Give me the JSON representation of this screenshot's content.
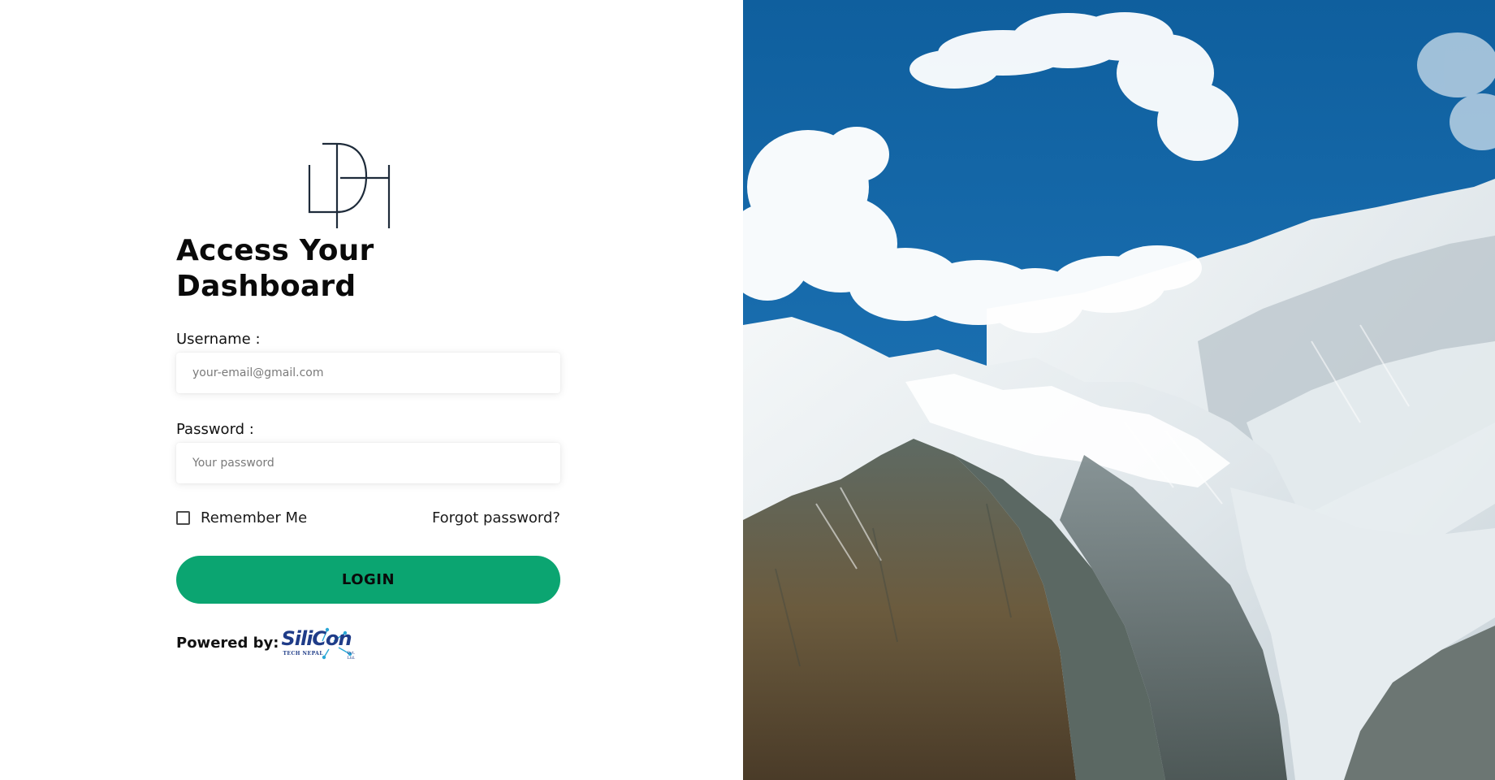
{
  "login": {
    "title": "Access Your Dashboard",
    "username_label": "Username :",
    "username_placeholder": "your-email@gmail.com",
    "password_label": "Password :",
    "password_placeholder": "Your password",
    "remember_label": "Remember Me",
    "remember_checked": false,
    "forgot_label": "Forgot password?",
    "login_label": "LOGIN"
  },
  "footer": {
    "powered_label": "Powered by:",
    "brand_name": "SiliCon",
    "brand_sub": "TECH NEPAL",
    "brand_suffix": "Pvt. Ltd."
  },
  "logo": {
    "letters": "LDH"
  },
  "hero": {
    "icon": "mountain-landscape-image"
  },
  "colors": {
    "accent": "#0ba571",
    "brand": "#1f3c88",
    "sky": "#1c6aa8"
  }
}
